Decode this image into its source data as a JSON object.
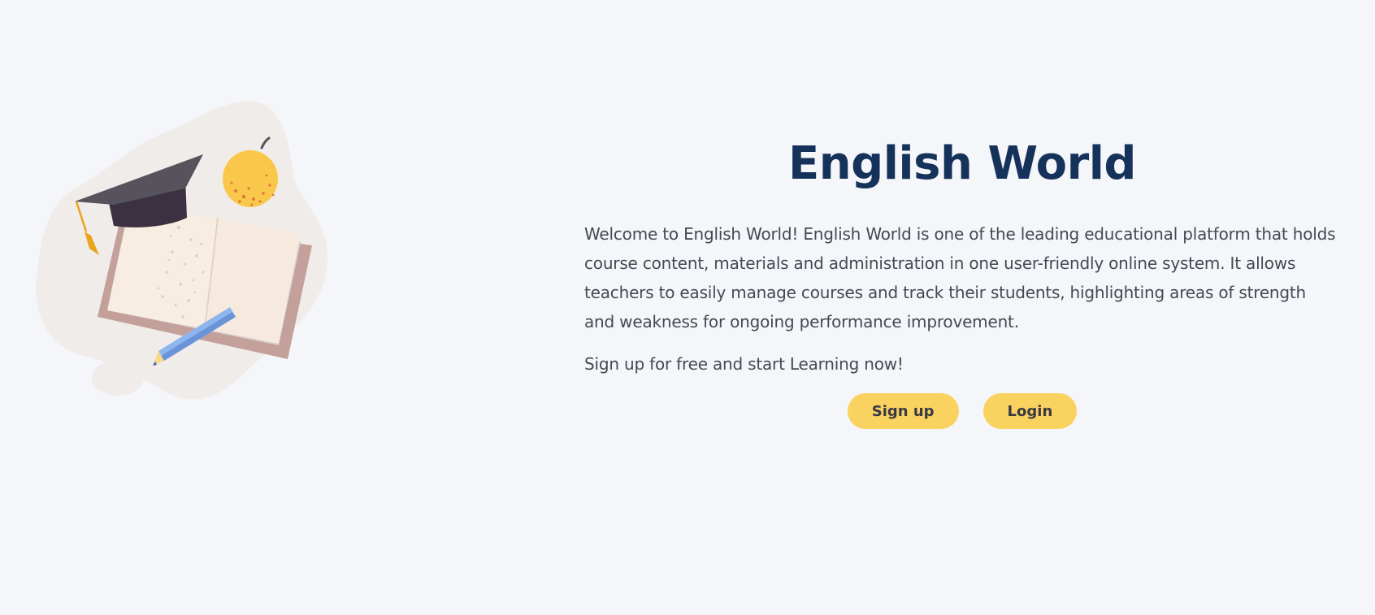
{
  "hero": {
    "title": "English World",
    "description": "Welcome to English World! English World is one of the leading educational platform that holds course content, materials and administration in one user-friendly online system. It allows teachers to easily manage courses and track their students, highlighting areas of strength and weakness for ongoing performance improvement.",
    "cta_text": "Sign up for free and start Learning now!",
    "signup_label": "Sign up",
    "login_label": "Login"
  },
  "illustration": {
    "name": "education-illustration",
    "icons": [
      "graduation-cap-icon",
      "apple-icon",
      "book-icon",
      "pencil-icon"
    ]
  },
  "colors": {
    "background": "#f5f6fa",
    "title": "#14325a",
    "body_text": "#444953",
    "button": "#f9d25f",
    "button_text": "#3a3a44"
  }
}
